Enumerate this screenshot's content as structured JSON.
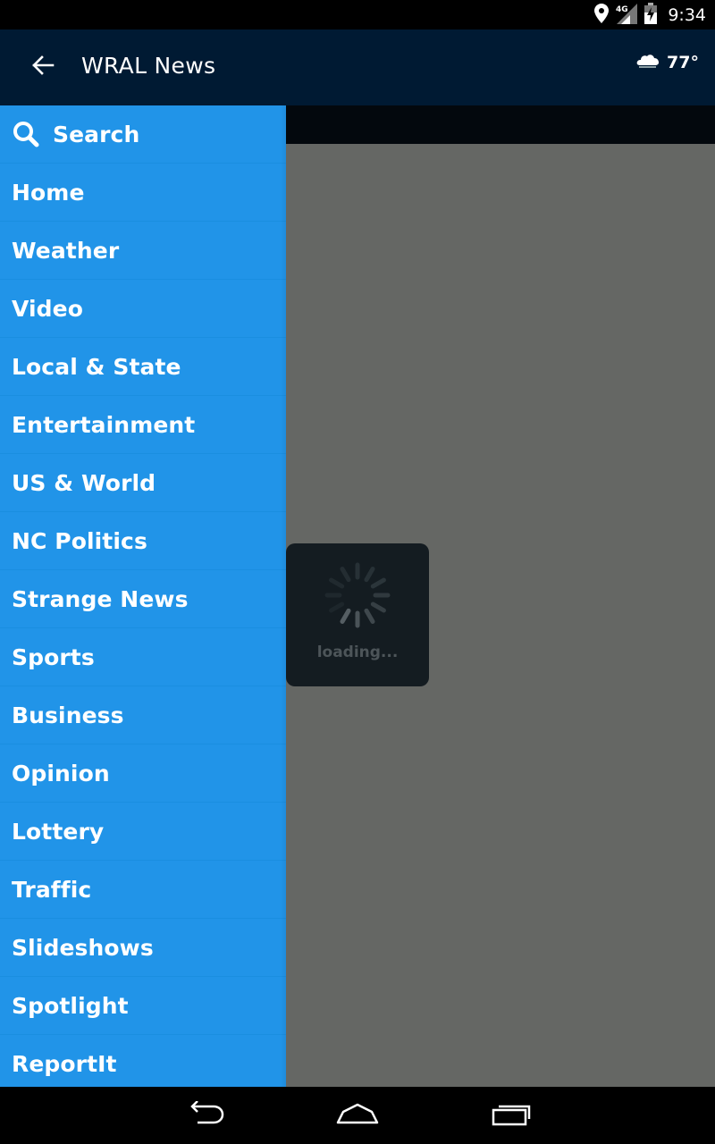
{
  "status_bar": {
    "time": "9:34",
    "icons": [
      "location-icon",
      "signal-4g-icon",
      "battery-icon"
    ]
  },
  "action_bar": {
    "back_icon": "arrow-left-icon",
    "title": "WRAL News",
    "weather_icon": "partly-cloudy-icon",
    "temperature": "77°"
  },
  "drawer": {
    "search_label": "Search",
    "items": [
      {
        "label": "Home"
      },
      {
        "label": "Weather"
      },
      {
        "label": "Video"
      },
      {
        "label": "Local & State"
      },
      {
        "label": "Entertainment"
      },
      {
        "label": "US & World"
      },
      {
        "label": "NC Politics"
      },
      {
        "label": "Strange News"
      },
      {
        "label": "Sports"
      },
      {
        "label": "Business"
      },
      {
        "label": "Opinion"
      },
      {
        "label": "Lottery"
      },
      {
        "label": "Traffic"
      },
      {
        "label": "Slideshows"
      },
      {
        "label": "Spotlight"
      },
      {
        "label": "ReportIt"
      }
    ]
  },
  "loading": {
    "text": "loading..."
  },
  "nav_bar": {
    "buttons": [
      "back-icon",
      "home-icon",
      "recents-icon"
    ]
  },
  "colors": {
    "drawer_bg": "#2194e8",
    "action_bar_bg": "#001a33",
    "content_bg": "#656764"
  }
}
